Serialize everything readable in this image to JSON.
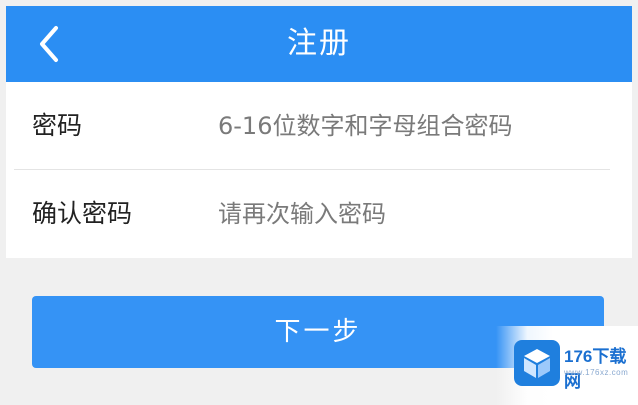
{
  "header": {
    "title": "注册",
    "back_icon": "chevron-left-icon",
    "background": "#2b8ef3"
  },
  "form": {
    "rows": [
      {
        "label": "密码",
        "placeholder": "6-16位数字和字母组合密码",
        "value": ""
      },
      {
        "label": "确认密码",
        "placeholder": "请再次输入密码",
        "value": ""
      }
    ]
  },
  "next_button": {
    "label": "下一步",
    "color": "#3593f5"
  },
  "watermark": {
    "text": "176下载网",
    "url": "www.176xz.com",
    "logo_icon": "box-logo-icon"
  }
}
